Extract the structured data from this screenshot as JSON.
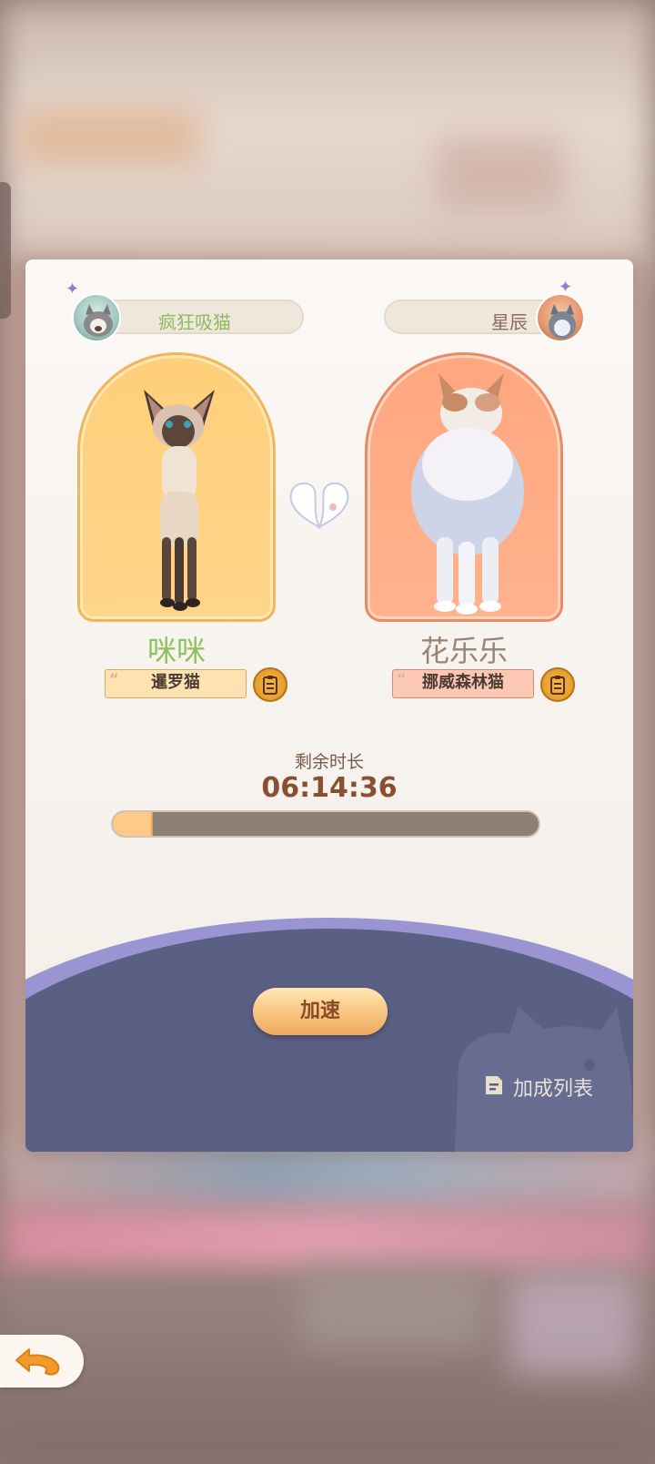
{
  "owners": {
    "left": {
      "name": "疯狂吸猫"
    },
    "right": {
      "name": "星辰"
    }
  },
  "cats": [
    {
      "name": "咪咪",
      "breed": "暹罗猫",
      "name_color": "#8fc25e",
      "arch_color": "#ffcf7a"
    },
    {
      "name": "花乐乐",
      "breed": "挪威森林猫",
      "name_color": "#9a8374",
      "arch_color": "#ffa77f"
    }
  ],
  "timer": {
    "label": "剩余时长",
    "value": "06:14:36",
    "progress": 0.09
  },
  "actions": {
    "speed_up": "加速",
    "bonus_list": "加成列表"
  },
  "icons": [
    "sparkle-icon",
    "heart-paws-icon",
    "clipboard-icon",
    "document-icon",
    "back-arrow-icon"
  ],
  "colors": {
    "panel_bottom": "#5a5f84",
    "accent_arc": "#9a94d2",
    "button": "#f7c27a"
  }
}
